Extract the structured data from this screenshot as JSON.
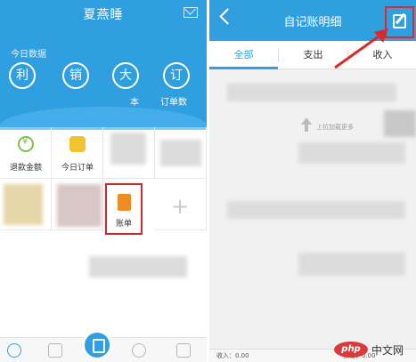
{
  "left_screen": {
    "title": "夏燕睡",
    "today_label": "今日数据",
    "stats": [
      {
        "char": "利"
      },
      {
        "char": "销"
      },
      {
        "char": "大"
      },
      {
        "char": "订"
      }
    ],
    "stat_captions": [
      "本",
      "订单数"
    ],
    "grid_items": [
      {
        "label": "退款金额"
      },
      {
        "label": "今日订单"
      },
      {
        "label": "账单"
      }
    ],
    "plus": "+"
  },
  "right_screen": {
    "title": "自记账明细",
    "tabs": [
      "全部",
      "支出",
      "收入"
    ],
    "pull_hint": "上拉加载更多",
    "income_label": "收入：0.00",
    "balance_label": "余汇：0.00"
  },
  "watermark": {
    "logo": "php",
    "text": "中文网"
  },
  "colors": {
    "primary_blue": "#2f9fe0",
    "highlight_red": "#e02a2a"
  }
}
